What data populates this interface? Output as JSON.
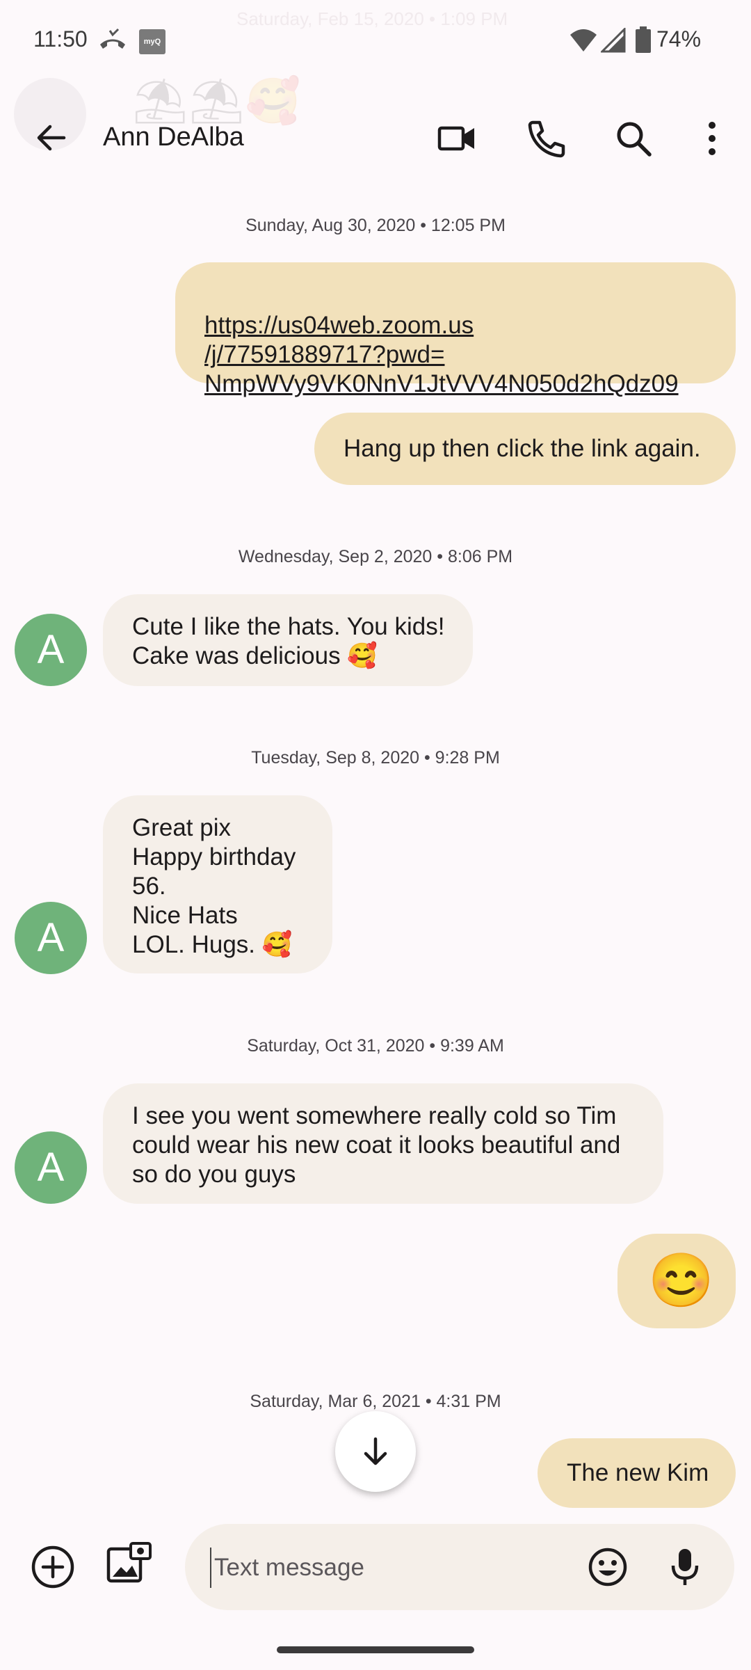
{
  "status_bar": {
    "time": "11:50",
    "myq_label": "myQ",
    "battery": "74%"
  },
  "ghost": {
    "date": "Saturday, Feb 15, 2020 • 1:09 PM",
    "emoji": "⛱⛱🥰"
  },
  "header": {
    "contact_name": "Ann DeAlba"
  },
  "messages": {
    "date1": "Sunday, Aug 30, 2020 • 12:05 PM",
    "m1_text": "https://us04web.zoom.us\n/j/77591889717?pwd=\nNmpWVy9VK0NnV1JtVVV4N050d2hQdz09",
    "m2_text": "Hang up then click the link again.",
    "date2": "Wednesday, Sep 2, 2020 • 8:06 PM",
    "m3_text": "Cute I like the hats. You kids!\nCake was delicious 🥰",
    "date3": "Tuesday, Sep 8, 2020 • 9:28 PM",
    "m4_text": "Great pix\nHappy birthday\n    56.\nNice Hats\nLOL. Hugs. 🥰",
    "date4": "Saturday, Oct 31, 2020 • 9:39 AM",
    "m5_text": "I see you went somewhere really cold so Tim\ncould wear his new coat it looks beautiful and\nso do you guys",
    "m6_text": "😊",
    "date5": "Saturday, Mar 6, 2021 • 4:31 PM",
    "m7_text": "The new Kim",
    "avatar_letter": "A"
  },
  "composer": {
    "placeholder": "Text message"
  },
  "colors": {
    "outgoing_bubble": "#f2e1bb",
    "incoming_bubble": "#f5efe9",
    "avatar": "#6fb37a",
    "background": "#fdf9fb"
  }
}
